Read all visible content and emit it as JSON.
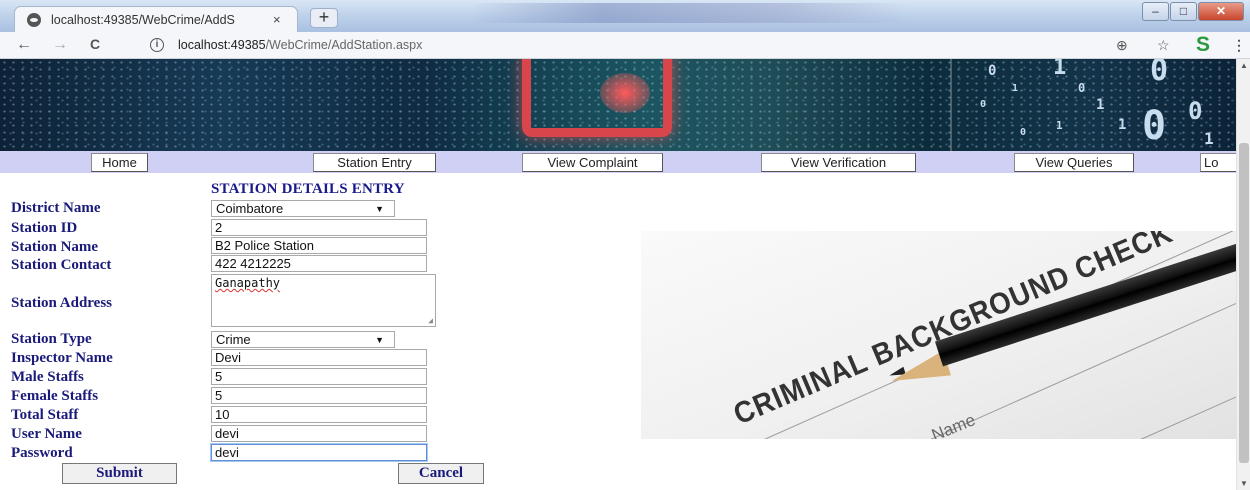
{
  "browser": {
    "tab_title": "localhost:49385/WebCrime/AddS",
    "tab_close": "×",
    "new_tab": "+",
    "win_min": "–",
    "win_max": "□",
    "win_close": "✕",
    "url_host": "localhost:49385",
    "url_path": "/WebCrime/AddStation.aspx",
    "back": "←",
    "forward": "→",
    "reload": "C",
    "info": "i",
    "zoom_icon": "⊕",
    "star_icon": "☆",
    "ext_icon": "S",
    "menu_icon": "⋮"
  },
  "banner": {
    "digits": [
      "0",
      "1",
      "0",
      "1",
      "0",
      "0",
      "1",
      "0",
      "1",
      "1",
      "0",
      "0",
      "1"
    ]
  },
  "menu": {
    "items": [
      "Home",
      "Station Entry",
      "View Complaint",
      "View Verification",
      "View Queries",
      "Lo"
    ]
  },
  "form": {
    "title": "STATION DETAILS ENTRY",
    "labels": {
      "district": "District Name",
      "station_id": "Station ID",
      "station_name": "Station Name",
      "contact": "Station Contact",
      "address": "Station Address",
      "type": "Station Type",
      "inspector": "Inspector Name",
      "male": "Male Staffs",
      "female": "Female Staffs",
      "total": "Total Staff",
      "username": "User Name",
      "password": "Password"
    },
    "values": {
      "district": "Coimbatore",
      "station_id": "2",
      "station_name": "B2 Police Station",
      "contact": "422 4212225",
      "address": "Ganapathy",
      "type": "Crime",
      "inspector": "Devi",
      "male": "5",
      "female": "5",
      "total": "10",
      "username": "devi",
      "password": "devi"
    },
    "submit": "Submit",
    "cancel": "Cancel"
  },
  "image": {
    "text": "CRIMINAL BACKGROUND CHECK",
    "hint": "Name"
  },
  "scroll": {
    "up": "▲",
    "down": "▼"
  }
}
